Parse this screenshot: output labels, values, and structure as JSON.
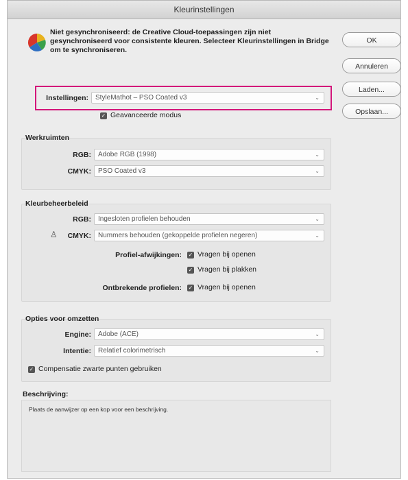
{
  "window": {
    "title": "Kleurinstellingen"
  },
  "message": "Niet gesynchroniseerd: de Creative Cloud-toepassingen zijn niet gesynchroniseerd voor consistente kleuren. Selecteer Kleurinstellingen in Bridge om te synchroniseren.",
  "buttons": {
    "ok": "OK",
    "cancel": "Annuleren",
    "load": "Laden...",
    "save": "Opslaan..."
  },
  "settings": {
    "label": "Instellingen:",
    "value": "StyleMathot – PSO Coated v3",
    "advanced_label": "Geavanceerde modus"
  },
  "workspaces": {
    "title": "Werkruimten",
    "rgb_label": "RGB:",
    "rgb_value": "Adobe RGB (1998)",
    "cmyk_label": "CMYK:",
    "cmyk_value": "PSO Coated v3"
  },
  "policies": {
    "title": "Kleurbeheerbeleid",
    "rgb_label": "RGB:",
    "rgb_value": "Ingesloten profielen behouden",
    "cmyk_label": "CMYK:",
    "cmyk_value": "Nummers behouden (gekoppelde profielen negeren)",
    "mismatch_label": "Profiel-afwijkingen:",
    "ask_open": "Vragen bij openen",
    "ask_paste": "Vragen bij plakken",
    "missing_label": "Ontbrekende profielen:",
    "missing_ask_open": "Vragen bij openen"
  },
  "conversion": {
    "title": "Opties voor omzetten",
    "engine_label": "Engine:",
    "engine_value": "Adobe (ACE)",
    "intent_label": "Intentie:",
    "intent_value": "Relatief colorimetrisch",
    "bpc_label": "Compensatie zwarte punten gebruiken"
  },
  "description": {
    "title": "Beschrijving:",
    "text": "Plaats de aanwijzer op een kop voor een beschrijving."
  },
  "colors": {
    "highlight": "#d3157a"
  }
}
